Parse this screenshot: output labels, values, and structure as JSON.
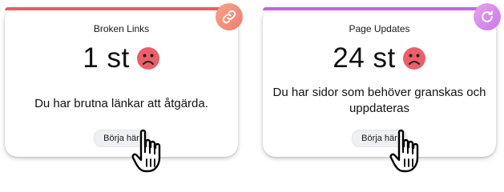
{
  "cards": [
    {
      "title": "Broken Links",
      "value": "1 st",
      "message": "Du har brutna länkar att åtgärda.",
      "button_label": "Börja här",
      "accent": "#e85d6a",
      "badge_icon": "link-icon",
      "status_icon": "sad-face-icon"
    },
    {
      "title": "Page Updates",
      "value": "24 st",
      "message": "Du har sidor som behöver granskas och uppdateras",
      "button_label": "Börja här",
      "accent": "#c266e0",
      "badge_icon": "refresh-icon",
      "status_icon": "sad-face-icon"
    }
  ],
  "colors": {
    "sad_face": "#e8606a",
    "button_bg": "#eef0f3"
  },
  "cursor_icon": "hand-pointer-icon"
}
